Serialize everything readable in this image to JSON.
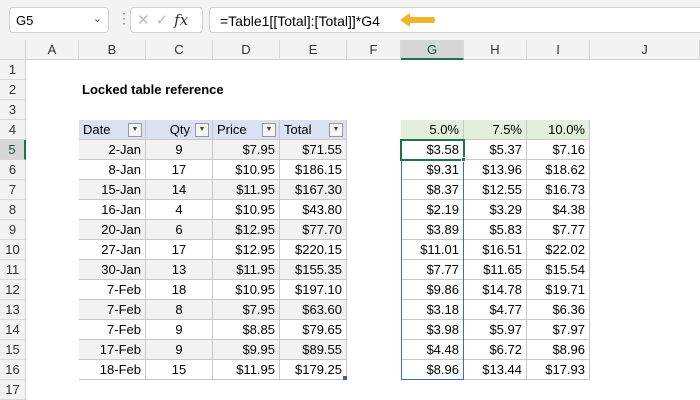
{
  "toolbar": {
    "name_box": "G5",
    "formula": "=Table1[[Total]:[Total]]*G4",
    "fx_label": "fx",
    "cancel": "✕",
    "enter": "✓"
  },
  "columns": [
    "A",
    "B",
    "C",
    "D",
    "E",
    "F",
    "G",
    "H",
    "I",
    "J"
  ],
  "rows": [
    "1",
    "2",
    "3",
    "4",
    "5",
    "6",
    "7",
    "8",
    "9",
    "10",
    "11",
    "12",
    "13",
    "14",
    "15",
    "16",
    "17"
  ],
  "title": "Locked table reference",
  "table": {
    "headers": [
      "Date",
      "Qty",
      "Price",
      "Total"
    ],
    "rows": [
      [
        "2-Jan",
        "9",
        "$7.95",
        "$71.55"
      ],
      [
        "8-Jan",
        "17",
        "$10.95",
        "$186.15"
      ],
      [
        "15-Jan",
        "14",
        "$11.95",
        "$167.30"
      ],
      [
        "16-Jan",
        "4",
        "$10.95",
        "$43.80"
      ],
      [
        "20-Jan",
        "6",
        "$12.95",
        "$77.70"
      ],
      [
        "27-Jan",
        "17",
        "$12.95",
        "$220.15"
      ],
      [
        "30-Jan",
        "13",
        "$11.95",
        "$155.35"
      ],
      [
        "7-Feb",
        "18",
        "$10.95",
        "$197.10"
      ],
      [
        "7-Feb",
        "8",
        "$7.95",
        "$63.60"
      ],
      [
        "7-Feb",
        "9",
        "$8.85",
        "$79.65"
      ],
      [
        "17-Feb",
        "9",
        "$9.95",
        "$89.55"
      ],
      [
        "18-Feb",
        "15",
        "$11.95",
        "$179.25"
      ]
    ]
  },
  "rates": {
    "headers": [
      "5.0%",
      "7.5%",
      "10.0%"
    ],
    "rows": [
      [
        "$3.58",
        "$5.37",
        "$7.16"
      ],
      [
        "$9.31",
        "$13.96",
        "$18.62"
      ],
      [
        "$8.37",
        "$12.55",
        "$16.73"
      ],
      [
        "$2.19",
        "$3.29",
        "$4.38"
      ],
      [
        "$3.89",
        "$5.83",
        "$7.77"
      ],
      [
        "$11.01",
        "$16.51",
        "$22.02"
      ],
      [
        "$7.77",
        "$11.65",
        "$15.54"
      ],
      [
        "$9.86",
        "$14.78",
        "$19.71"
      ],
      [
        "$3.18",
        "$4.77",
        "$6.36"
      ],
      [
        "$3.98",
        "$5.97",
        "$7.97"
      ],
      [
        "$4.48",
        "$6.72",
        "$8.96"
      ],
      [
        "$8.96",
        "$13.44",
        "$17.93"
      ]
    ]
  },
  "colors": {
    "accent": "#217346",
    "arrow": "#f0b429",
    "table_header": "#d9e1f2",
    "rate_header": "#e2efda"
  }
}
